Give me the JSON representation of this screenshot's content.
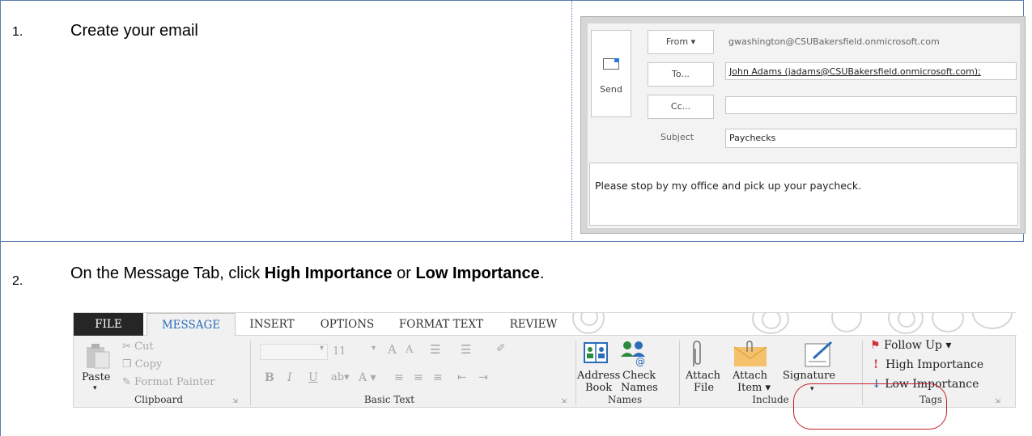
{
  "steps": [
    {
      "num": "1.",
      "text": "Create your email"
    },
    {
      "num": "2.",
      "pre": "On the Message Tab, click ",
      "bold1": "High Importance",
      "mid": " or ",
      "bold2": "Low Importance",
      "post": "."
    }
  ],
  "compose": {
    "send_label": "Send",
    "from_label": "From ▾",
    "from_value": "gwashington@CSUBakersfield.onmicrosoft.com",
    "to_label": "To...",
    "to_value": "John Adams (jadams@CSUBakersfield.onmicrosoft.com);",
    "cc_label": "Cc...",
    "cc_value": "",
    "subject_label": "Subject",
    "subject_value": "Paychecks",
    "body": "Please stop by my office and pick up your paycheck."
  },
  "ribbon": {
    "tabs": [
      "FILE",
      "MESSAGE",
      "INSERT",
      "OPTIONS",
      "FORMAT TEXT",
      "REVIEW"
    ],
    "clipboard": {
      "paste": "Paste",
      "cut": "Cut",
      "copy": "Copy",
      "format_painter": "Format Painter",
      "label": "Clipboard"
    },
    "basic_text": {
      "font_size": "11",
      "label": "Basic Text"
    },
    "names": {
      "address_book_1": "Address",
      "address_book_2": "Book",
      "check_names_1": "Check",
      "check_names_2": "Names",
      "label": "Names"
    },
    "include": {
      "attach_file_1": "Attach",
      "attach_file_2": "File",
      "attach_item_1": "Attach",
      "attach_item_2": "Item ▾",
      "signature": "Signature",
      "label": "Include"
    },
    "tags": {
      "follow_up": "Follow Up ▾",
      "high_importance": "High Importance",
      "low_importance": "Low Importance",
      "label": "Tags"
    }
  },
  "colors": {
    "accent_blue": "#2b6cb8",
    "highlight_red": "#c4202a",
    "flag_red": "#d13438"
  }
}
